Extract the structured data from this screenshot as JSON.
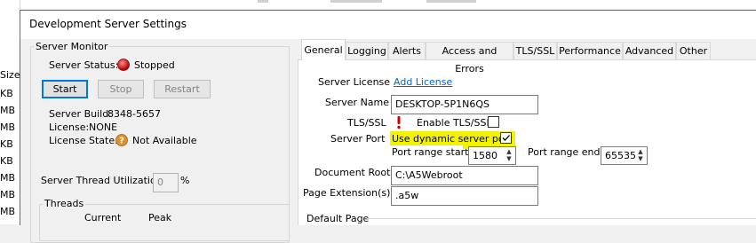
{
  "background": {
    "sizes": [
      "Size",
      "KB",
      "MB",
      "MB",
      "KB",
      "KB",
      "MB",
      "MB",
      "MB"
    ]
  },
  "window": {
    "title": "Development Server Settings"
  },
  "monitor": {
    "group_title": "Server Monitor",
    "status_label": "Server Status:",
    "status_value": "Stopped",
    "status_color": "#d62020",
    "buttons": {
      "start": "Start",
      "stop": "Stop",
      "restart": "Restart"
    },
    "build_label": "Server Build:",
    "build_value": "8348-5657",
    "license_label": "License:",
    "license_value": "NONE",
    "license_state_label": "License State:",
    "license_state_value": "Not Available",
    "thread_util_label": "Server Thread Utilization:",
    "thread_util_value": "0",
    "thread_util_unit": "%"
  },
  "threads": {
    "group_title": "Threads",
    "col_current": "Current",
    "col_peak": "Peak"
  },
  "tabs": [
    "General",
    "Logging",
    "Alerts",
    "Access and Errors",
    "TLS/SSL",
    "Performance",
    "Advanced",
    "Other"
  ],
  "active_tab": "General",
  "general": {
    "server_license_label": "Server License",
    "add_license_link": "Add License",
    "server_name_label": "Server Name",
    "server_name_value": "DESKTOP-5P1N6QS",
    "tls_label": "TLS/SSL",
    "enable_tls_label": "Enable TLS/SSL",
    "enable_tls_checked": false,
    "server_port_label": "Server Port",
    "dynamic_port_label": "Use dynamic server port",
    "dynamic_port_checked": true,
    "port_start_label": "Port range start:",
    "port_start_value": "1580",
    "port_end_label": "Port range end:",
    "port_end_value": "65535",
    "doc_root_label": "Document Root",
    "doc_root_value": "C:\\A5Webroot",
    "page_ext_label": "Page Extension(s)",
    "page_ext_value": ".a5w",
    "default_page_label": "Default Page"
  }
}
